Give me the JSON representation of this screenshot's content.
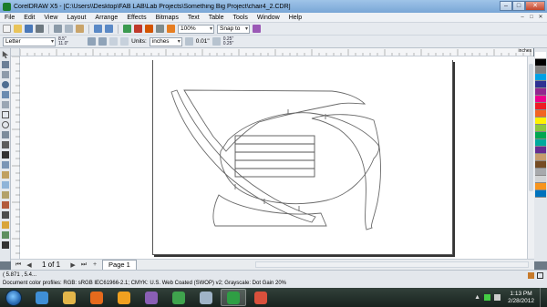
{
  "window": {
    "title": "CorelDRAW X5 - [C:\\Users\\\\Desktop\\FAB LAB\\Lab Projects\\Something Big Project\\chair4_2.CDR]",
    "controls": {
      "minimize": "–",
      "maximize": "□",
      "close": "✕"
    }
  },
  "menu": {
    "items": [
      "File",
      "Edit",
      "View",
      "Layout",
      "Arrange",
      "Effects",
      "Bitmaps",
      "Text",
      "Table",
      "Tools",
      "Window",
      "Help"
    ]
  },
  "toolbar": {
    "zoom": "100%",
    "snap": "Snap to"
  },
  "property_bar": {
    "page_size": "Letter",
    "width": "8.5\"",
    "height": "11.0\"",
    "units_label": "Units:",
    "units_value": "inches",
    "nudge": "0.01\"",
    "dup_x": "0.25\"",
    "dup_y": "0.25\""
  },
  "ruler": {
    "unit": "inches"
  },
  "page_nav": {
    "count": "1 of 1",
    "tab": "Page 1"
  },
  "status": {
    "coords": "( 5.871 , 5.4...",
    "profile": "Document color profiles: RGB: sRGB IEC61966-2.1; CMYK: U.S. Web Coated (SWOP) v2; Grayscale: Dot Gain 20%"
  },
  "taskbar": {
    "time": "1:13 PM",
    "date": "2/28/2012"
  },
  "palette": {
    "colors": [
      "#ffffff",
      "#000000",
      "#7f7f7f",
      "#00a0e3",
      "#2e3192",
      "#92278f",
      "#ec008c",
      "#ed1c24",
      "#f26522",
      "#fff200",
      "#8dc63f",
      "#00a651",
      "#00a99d",
      "#662d91",
      "#c69c6d",
      "#754c24",
      "#a7a9ac",
      "#d1d3d4",
      "#f7941d",
      "#0072bc"
    ]
  },
  "taskbar_apps": [
    {
      "name": "ie-icon",
      "color": "#3f8fd6"
    },
    {
      "name": "explorer-icon",
      "color": "#e3b64a"
    },
    {
      "name": "firefox-icon",
      "color": "#e66a1c"
    },
    {
      "name": "media-player-icon",
      "color": "#f0a020"
    },
    {
      "name": "paint-icon",
      "color": "#8a5fb5"
    },
    {
      "name": "green-app-icon",
      "color": "#3fa34d"
    },
    {
      "name": "generic-app-icon",
      "color": "#a0b4c8"
    },
    {
      "name": "coreldraw-icon",
      "color": "#2f9e44"
    },
    {
      "name": "corelcapture-icon",
      "color": "#d9503c"
    }
  ]
}
